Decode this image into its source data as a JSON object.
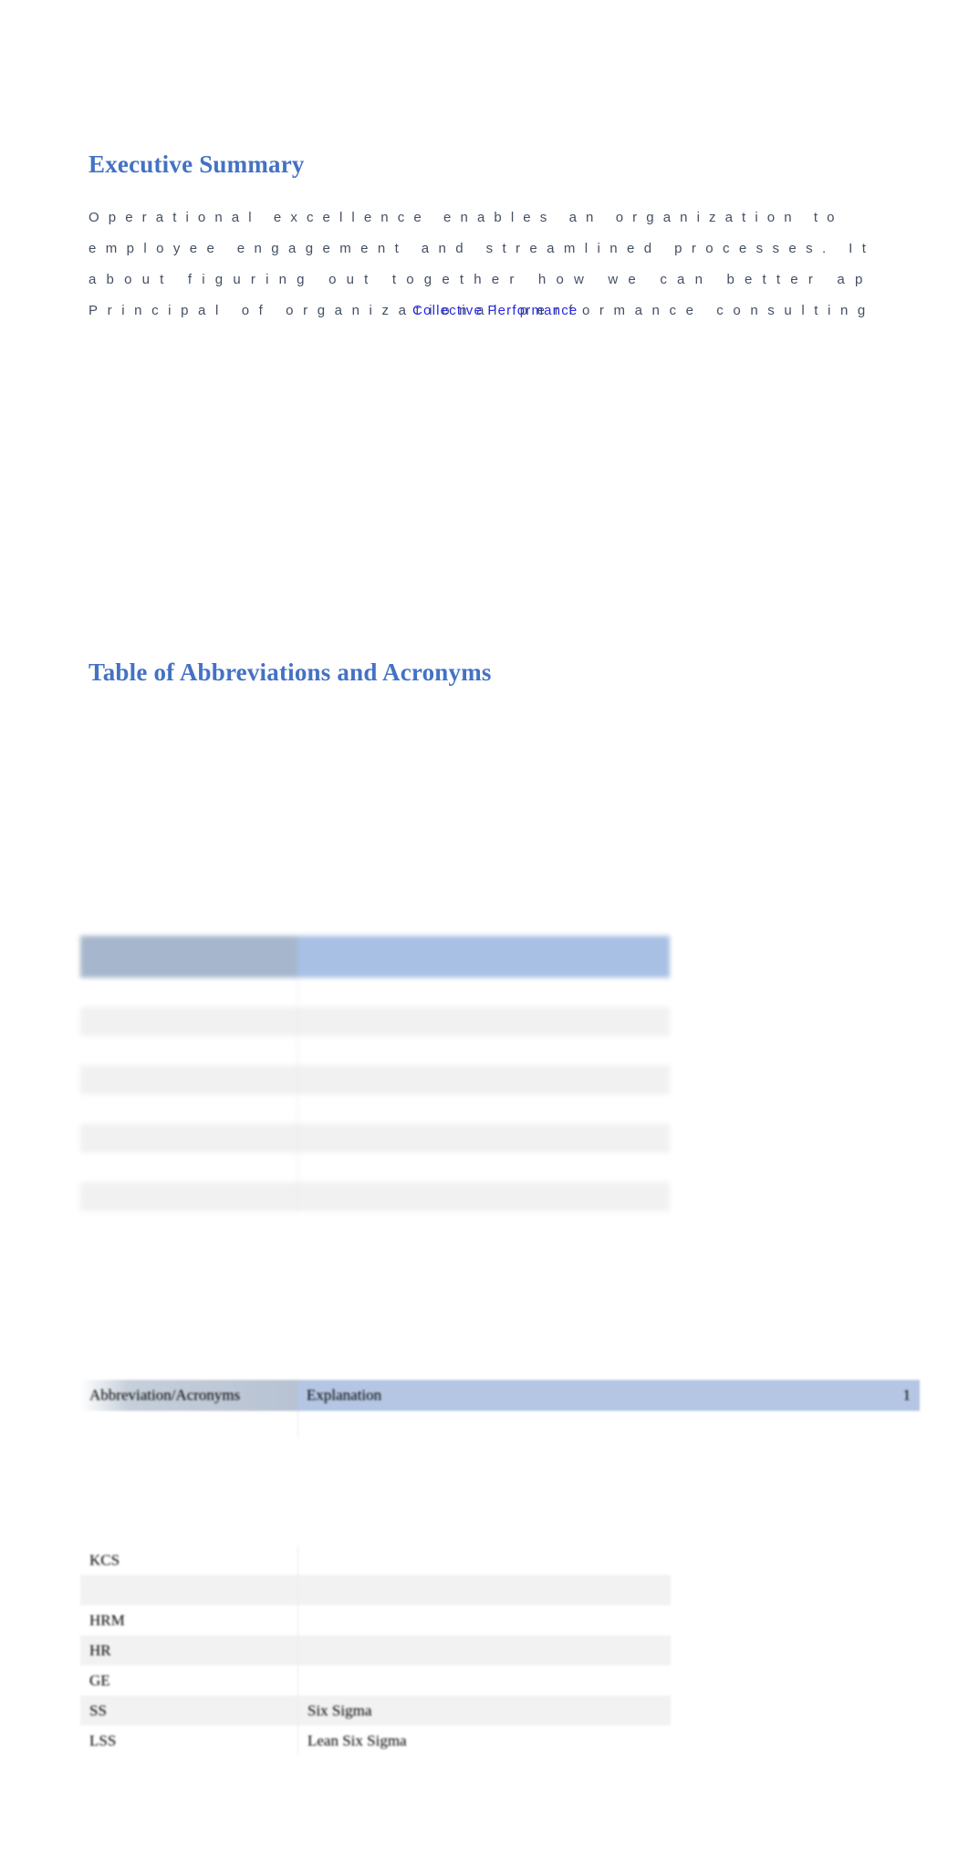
{
  "document": {
    "heading_executive_summary": "Executive Summary",
    "heading_abbreviations": "Table of Abbreviations and Acronyms"
  },
  "paragraph": {
    "line1": "Operational excellence enables an organization to",
    "line2": "employee engagement and streamlined processes. It",
    "line3": "about figuring out together how we can better ap",
    "line4": "Principal of organizational performance consulting",
    "overlay_text": "Collective Performance",
    "overlay_color": "#2727e8",
    "text_color": "#434f63"
  },
  "colors": {
    "heading_blue": "#4472c4",
    "header_cell_grey_blue": "#a6b6cc",
    "header_cell_light_blue": "#a8c0e4",
    "row_stripe": "#f1f1f1"
  },
  "table_ghost": {
    "headers": [
      "",
      ""
    ],
    "rows": [
      [
        "",
        ""
      ],
      [
        "",
        ""
      ],
      [
        "",
        ""
      ],
      [
        "",
        ""
      ],
      [
        "",
        ""
      ],
      [
        "",
        ""
      ],
      [
        "",
        ""
      ],
      [
        "",
        ""
      ]
    ]
  },
  "table_header_strip": {
    "headers": [
      "Abbreviation/Acronyms",
      "Explanation",
      "1"
    ],
    "rows": [
      [
        "",
        ""
      ]
    ]
  },
  "table_abbreviations": {
    "headers": [
      "Abbreviation/Acronyms",
      "Explanation"
    ],
    "rows": [
      [
        "KCS",
        ""
      ],
      [
        "",
        ""
      ],
      [
        "HRM",
        ""
      ],
      [
        "HR",
        ""
      ],
      [
        "GE",
        ""
      ],
      [
        "SS",
        "Six Sigma"
      ],
      [
        "LSS",
        "Lean Six Sigma"
      ]
    ]
  }
}
